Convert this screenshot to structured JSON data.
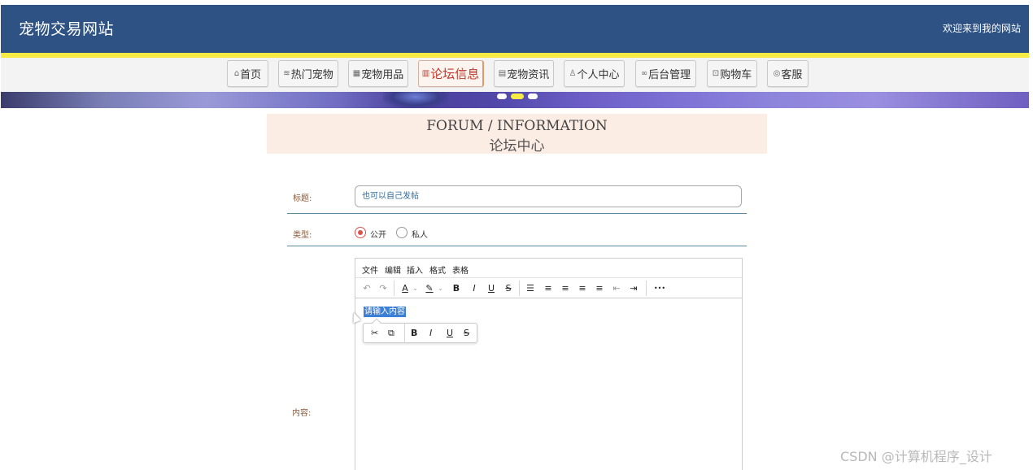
{
  "header": {
    "site_title": "宠物交易网站",
    "welcome": "欢迎来到我的网站",
    "bg_color": "#2e5283",
    "strip_color": "#f7ec43"
  },
  "nav": {
    "items": [
      {
        "icon": "⌂",
        "icon_name": "home-icon",
        "label": "首页"
      },
      {
        "icon": "≋",
        "icon_name": "pets-icon",
        "label": "热门宠物"
      },
      {
        "icon": "▦",
        "icon_name": "supplies-icon",
        "label": "宠物用品"
      },
      {
        "icon": "▥",
        "icon_name": "forum-icon",
        "label": "论坛信息"
      },
      {
        "icon": "▤",
        "icon_name": "news-icon",
        "label": "宠物资讯"
      },
      {
        "icon": "♙",
        "icon_name": "user-icon",
        "label": "个人中心"
      },
      {
        "icon": "∞",
        "icon_name": "link-icon",
        "label": "后台管理"
      },
      {
        "icon": "⊡",
        "icon_name": "cart-icon",
        "label": "购物车"
      },
      {
        "icon": "◎",
        "icon_name": "service-icon",
        "label": "客服"
      }
    ],
    "active_index": 3,
    "active_color": "#c0392b"
  },
  "banner": {
    "dots_count": 3,
    "active_dot": 1
  },
  "page": {
    "title_en": "FORUM / INFORMATION",
    "title_cn": "论坛中心"
  },
  "form": {
    "title_label": "标题:",
    "title_value": "也可以自己发帖",
    "type_label": "类型:",
    "type_options": [
      "公开",
      "私人"
    ],
    "type_selected": "公开",
    "content_label": "内容:"
  },
  "editor": {
    "menu": [
      "文件",
      "编辑",
      "插入",
      "格式",
      "表格"
    ],
    "toolbar": {
      "undo": "↶",
      "redo": "↷",
      "text_color": "A",
      "highlight": "✎",
      "bold": "B",
      "italic": "I",
      "underline": "U",
      "strike": "S",
      "list": "☰",
      "align_left": "≡",
      "align_center": "≡",
      "align_right": "≡",
      "justify": "≡",
      "outdent": "⇤",
      "indent": "⇥",
      "more": "•••"
    },
    "placeholder": "请输入内容",
    "quickbar": {
      "cut": "✂",
      "copy": "⧉",
      "bold": "B",
      "italic": "I",
      "underline": "U",
      "strike": "S"
    }
  },
  "watermark": "CSDN @计算机程序_设计"
}
